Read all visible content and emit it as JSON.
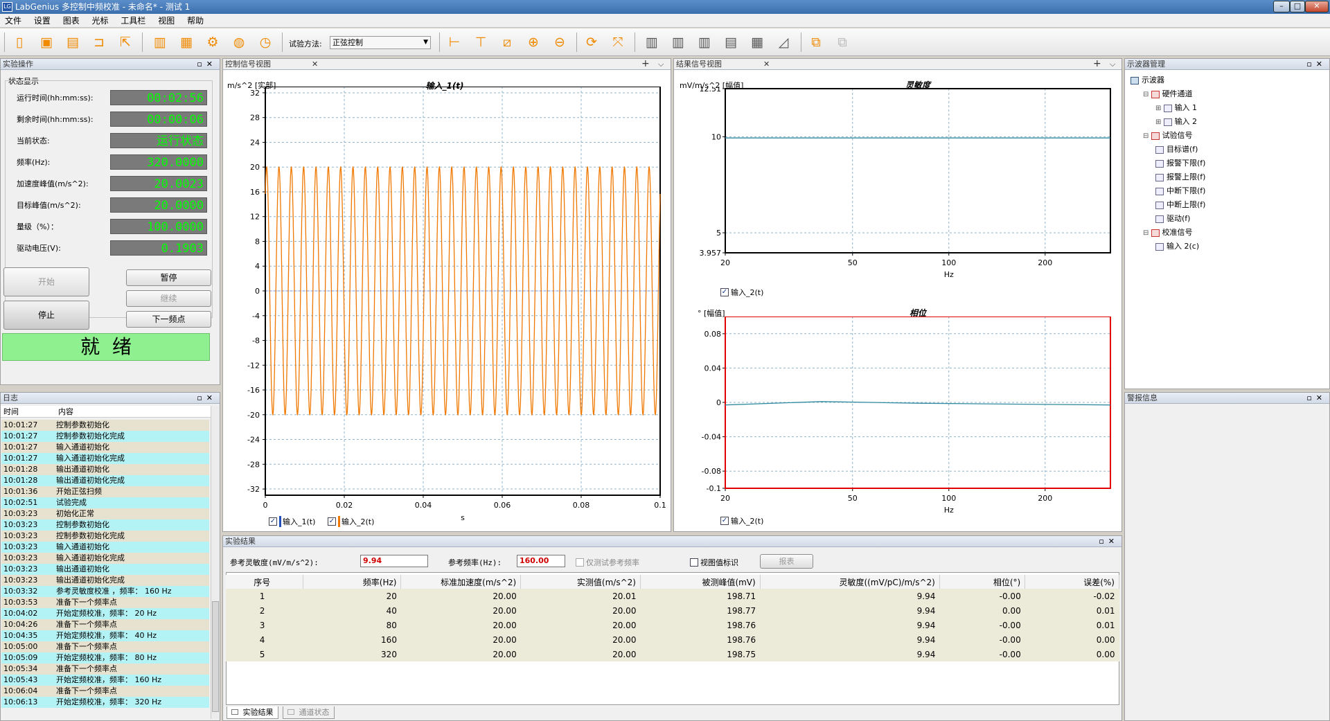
{
  "window": {
    "title": "LabGenius 多控制中频校准 - 未命名* - 测试 1",
    "app_icon_text": "LG"
  },
  "menu": [
    "文件",
    "设置",
    "图表",
    "光标",
    "工具栏",
    "视图",
    "帮助"
  ],
  "toolbar": {
    "method_label": "试验方法:",
    "method_value": "正弦控制"
  },
  "left_panel": {
    "title": "实验操作",
    "status_group": "状态显示",
    "fields": [
      {
        "label": "运行时间(hh:mm:ss):",
        "value": "00:02:56"
      },
      {
        "label": "剩余时间(hh:mm:ss):",
        "value": "00:00:06"
      },
      {
        "label": "当前状态:",
        "value": "运行状态"
      },
      {
        "label": "频率(Hz):",
        "value": "320.0000"
      },
      {
        "label": "加速度峰值(m/s^2):",
        "value": "20.0023"
      },
      {
        "label": "目标峰值(m/s^2):",
        "value": "20.0000"
      },
      {
        "label": "量级（%）：",
        "value": "100.0000"
      },
      {
        "label": "驱动电压(V):",
        "value": "0.1903"
      }
    ],
    "buttons": {
      "start": "开始",
      "pause": "暂停",
      "continue": "继续",
      "stop": "停止",
      "next": "下一频点"
    },
    "ready": "就  绪"
  },
  "log_panel": {
    "title": "日志",
    "headers": [
      "时间",
      "内容"
    ],
    "rows": [
      [
        "10:01:27",
        "控制参数初始化"
      ],
      [
        "10:01:27",
        "控制参数初始化完成"
      ],
      [
        "10:01:27",
        "输入通道初始化"
      ],
      [
        "10:01:27",
        "输入通道初始化完成"
      ],
      [
        "10:01:28",
        "输出通道初始化"
      ],
      [
        "10:01:28",
        "输出通道初始化完成"
      ],
      [
        "10:01:36",
        "开始正弦扫频"
      ],
      [
        "10:02:51",
        "试验完成"
      ],
      [
        "10:03:23",
        "初始化正常"
      ],
      [
        "10:03:23",
        "控制参数初始化"
      ],
      [
        "10:03:23",
        "控制参数初始化完成"
      ],
      [
        "10:03:23",
        "输入通道初始化"
      ],
      [
        "10:03:23",
        "输入通道初始化完成"
      ],
      [
        "10:03:23",
        "输出通道初始化"
      ],
      [
        "10:03:23",
        "输出通道初始化完成"
      ],
      [
        "10:03:32",
        "参考灵敏度校准 ，频率： 160 Hz"
      ],
      [
        "10:03:53",
        "准备下一个频率点"
      ],
      [
        "10:04:02",
        "开始定频校准，频率： 20 Hz"
      ],
      [
        "10:04:26",
        "准备下一个频率点"
      ],
      [
        "10:04:35",
        "开始定频校准，频率： 40 Hz"
      ],
      [
        "10:05:00",
        "准备下一个频率点"
      ],
      [
        "10:05:09",
        "开始定频校准，频率： 80 Hz"
      ],
      [
        "10:05:34",
        "准备下一个频率点"
      ],
      [
        "10:05:43",
        "开始定频校准，频率： 160 Hz"
      ],
      [
        "10:06:04",
        "准备下一个频率点"
      ],
      [
        "10:06:13",
        "开始定频校准，频率： 320 Hz"
      ]
    ]
  },
  "control_view": {
    "tab": "控制信号视图",
    "unit": "m/s^2 [实部]",
    "title": "输入_1(t)",
    "xlabel": "s",
    "legend": [
      "输入_1(t)",
      "输入_2(t)"
    ],
    "colors": {
      "series1": "#1f4fbf",
      "series2": "#f07800",
      "grid": "#8fb3c9"
    }
  },
  "result_view": {
    "tab": "结果信号视图",
    "sens_unit": "mV/m/s^2 [幅值]",
    "sens_title": "灵敏度",
    "phase_unit": "° [幅值]",
    "phase_title": "相位",
    "xlabel": "Hz",
    "legend": "输入_2(t)"
  },
  "chart_data": [
    {
      "type": "line",
      "title": "输入_1(t)",
      "xlabel": "s",
      "ylabel": "m/s^2 [实部]",
      "xlim": [
        0,
        0.1
      ],
      "ylim": [
        -33,
        33
      ],
      "x_ticks": [
        "0",
        "0.02",
        "0.04",
        "0.06",
        "0.08",
        "0.1"
      ],
      "y_ticks": [
        "32",
        "28",
        "24",
        "20",
        "16",
        "12",
        "8",
        "4",
        "0",
        "-4",
        "-8",
        "-12",
        "-16",
        "-20",
        "-24",
        "-28",
        "-32"
      ],
      "series": [
        {
          "name": "输入_1(t)",
          "frequency_hz": 0,
          "amplitude": 0
        },
        {
          "name": "输入_2(t)",
          "frequency_hz": 320,
          "amplitude": 20
        }
      ],
      "grid": true
    },
    {
      "type": "line",
      "title": "灵敏度",
      "xlabel": "Hz",
      "ylabel": "mV/m/s^2 [幅值]",
      "log_x": true,
      "xlim": [
        20,
        320
      ],
      "ylim": [
        3.957,
        12.51
      ],
      "x_ticks": [
        "20",
        "50",
        "100",
        "200"
      ],
      "y_ticks": [
        "12.51",
        "10",
        "5",
        "3.957"
      ],
      "series": [
        {
          "name": "输入_2(t)",
          "x": [
            20,
            40,
            80,
            160,
            320
          ],
          "y": [
            9.94,
            9.94,
            9.94,
            9.94,
            9.94
          ]
        }
      ],
      "grid": true
    },
    {
      "type": "line",
      "title": "相位",
      "xlabel": "Hz",
      "ylabel": "° [幅值]",
      "log_x": true,
      "xlim": [
        20,
        320
      ],
      "ylim": [
        -0.1,
        0.1
      ],
      "x_ticks": [
        "20",
        "50",
        "100",
        "200"
      ],
      "y_ticks": [
        "0.08",
        "0.04",
        "0",
        "-0.04",
        "-0.08",
        "-0.1"
      ],
      "series": [
        {
          "name": "输入_2(t)",
          "x": [
            20,
            40,
            80,
            160,
            320
          ],
          "y": [
            -0.003,
            0.001,
            -0.001,
            -0.002,
            -0.003
          ]
        }
      ],
      "grid": true
    }
  ],
  "tree": {
    "title": "示波器管理",
    "items": [
      {
        "label": "示波器",
        "level": 0
      },
      {
        "label": "硬件通道",
        "level": 1
      },
      {
        "label": "输入 1",
        "level": 2
      },
      {
        "label": "输入 2",
        "level": 2
      },
      {
        "label": "试验信号",
        "level": 1
      },
      {
        "label": "目标谱(f)",
        "level": 2
      },
      {
        "label": "报警下限(f)",
        "level": 2
      },
      {
        "label": "报警上限(f)",
        "level": 2
      },
      {
        "label": "中断下限(f)",
        "level": 2
      },
      {
        "label": "中断上限(f)",
        "level": 2
      },
      {
        "label": "驱动(f)",
        "level": 2
      },
      {
        "label": "校准信号",
        "level": 1
      },
      {
        "label": "输入 2(c)",
        "level": 2
      }
    ]
  },
  "alarm_panel": {
    "title": "警报信息"
  },
  "results": {
    "title": "实验结果",
    "ref_sens_label": "参考灵敏度(mV/m/s^2):",
    "ref_sens_value": "9.94",
    "ref_freq_label": "参考频率(Hz):",
    "ref_freq_value": "160.00",
    "only_ref_label": "仅测试参考频率",
    "view_label": "视图值标识",
    "report_button": "报表",
    "headers": [
      "序号",
      "频率(Hz)",
      "标准加速度(m/s^2)",
      "实测值(m/s^2)",
      "被测峰值(mV)",
      "灵敏度((mV/pC)/m/s^2)",
      "相位(°)",
      "误差(%)"
    ],
    "rows": [
      [
        "1",
        "20",
        "20.00",
        "20.01",
        "198.71",
        "9.94",
        "-0.00",
        "-0.02"
      ],
      [
        "2",
        "40",
        "20.00",
        "20.00",
        "198.77",
        "9.94",
        "0.00",
        "0.01"
      ],
      [
        "3",
        "80",
        "20.00",
        "20.00",
        "198.76",
        "9.94",
        "-0.00",
        "0.01"
      ],
      [
        "4",
        "160",
        "20.00",
        "20.00",
        "198.76",
        "9.94",
        "-0.00",
        "0.00"
      ],
      [
        "5",
        "320",
        "20.00",
        "20.00",
        "198.75",
        "9.94",
        "-0.00",
        "0.00"
      ]
    ],
    "tabs": [
      "实验结果",
      "通道状态"
    ]
  }
}
